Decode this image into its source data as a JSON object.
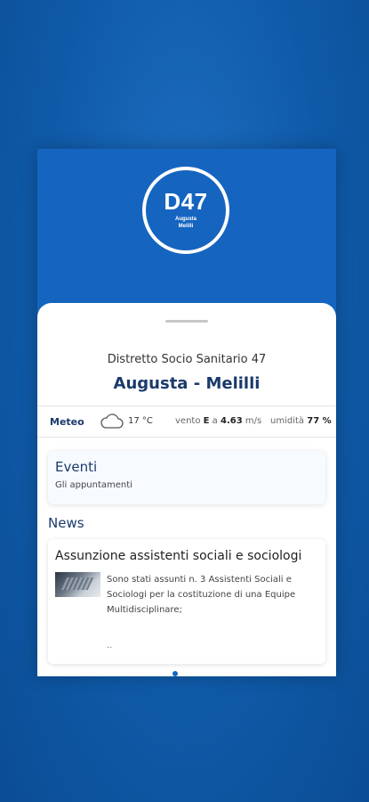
{
  "logo": {
    "code": "D47",
    "line1": "Augusta",
    "line2": "Melilli"
  },
  "header": {
    "district": "Distretto Socio Sanitario 47",
    "city": "Augusta - Melilli"
  },
  "weather": {
    "label": "Meteo",
    "icon": "cloud-icon",
    "temperature": "17 °C",
    "wind_prefix": "vento",
    "wind_dir": "E",
    "wind_mid": "a",
    "wind_speed": "4.63",
    "wind_unit": "m/s",
    "humidity_label": "umidità",
    "humidity": "77 %"
  },
  "events": {
    "title": "Eventi",
    "subtitle": "Gli appuntamenti"
  },
  "news": {
    "heading": "News",
    "items": [
      {
        "title": "Assunzione assistenti sociali e sociologi",
        "text": "Sono stati assunti n. 3 Assistenti Sociali e Sociologi per la costituzione di una Equipe Multidisciplinare;",
        "more": ".."
      }
    ]
  },
  "colors": {
    "primary": "#1565c0",
    "title": "#1a3a6b"
  }
}
